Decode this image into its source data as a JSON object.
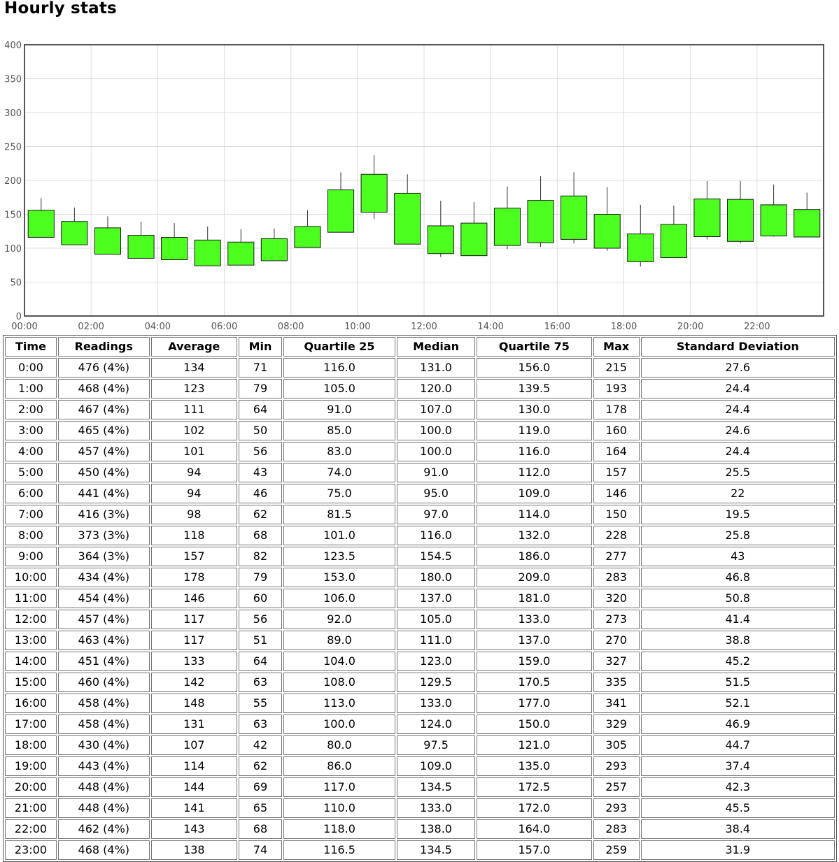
{
  "title": "Hourly stats",
  "chart_data": {
    "type": "candlestick",
    "ylim": [
      0,
      400
    ],
    "yticks": [
      "0",
      "50",
      "100",
      "150",
      "200",
      "250",
      "300",
      "350",
      "400"
    ],
    "xticks": [
      "00:00",
      "02:00",
      "04:00",
      "06:00",
      "08:00",
      "10:00",
      "12:00",
      "14:00",
      "16:00",
      "18:00",
      "20:00",
      "22:00"
    ],
    "box_color": "#4cff1f",
    "whisker_top": [
      174,
      160,
      147,
      139,
      137,
      132,
      128,
      129,
      156,
      212,
      237,
      209,
      170,
      168,
      191,
      206,
      212,
      190,
      164,
      163,
      199,
      199,
      194,
      182
    ],
    "whisker_bottom": [
      116,
      105,
      91,
      85,
      83,
      74,
      75,
      81.5,
      101,
      123.5,
      143,
      106,
      87,
      89,
      99,
      102,
      107,
      96,
      73,
      86,
      113,
      107,
      117,
      116.5
    ],
    "rows": [
      {
        "hour": 0,
        "q1": 116.0,
        "q3": 156.0
      },
      {
        "hour": 1,
        "q1": 105.0,
        "q3": 139.5
      },
      {
        "hour": 2,
        "q1": 91.0,
        "q3": 130.0
      },
      {
        "hour": 3,
        "q1": 85.0,
        "q3": 119.0
      },
      {
        "hour": 4,
        "q1": 83.0,
        "q3": 116.0
      },
      {
        "hour": 5,
        "q1": 74.0,
        "q3": 112.0
      },
      {
        "hour": 6,
        "q1": 75.0,
        "q3": 109.0
      },
      {
        "hour": 7,
        "q1": 81.5,
        "q3": 114.0
      },
      {
        "hour": 8,
        "q1": 101.0,
        "q3": 132.0
      },
      {
        "hour": 9,
        "q1": 123.5,
        "q3": 186.0
      },
      {
        "hour": 10,
        "q1": 153.0,
        "q3": 209.0
      },
      {
        "hour": 11,
        "q1": 106.0,
        "q3": 181.0
      },
      {
        "hour": 12,
        "q1": 92.0,
        "q3": 133.0
      },
      {
        "hour": 13,
        "q1": 89.0,
        "q3": 137.0
      },
      {
        "hour": 14,
        "q1": 104.0,
        "q3": 159.0
      },
      {
        "hour": 15,
        "q1": 108.0,
        "q3": 170.5
      },
      {
        "hour": 16,
        "q1": 113.0,
        "q3": 177.0
      },
      {
        "hour": 17,
        "q1": 100.0,
        "q3": 150.0
      },
      {
        "hour": 18,
        "q1": 80.0,
        "q3": 121.0
      },
      {
        "hour": 19,
        "q1": 86.0,
        "q3": 135.0
      },
      {
        "hour": 20,
        "q1": 117.0,
        "q3": 172.5
      },
      {
        "hour": 21,
        "q1": 110.0,
        "q3": 172.0
      },
      {
        "hour": 22,
        "q1": 118.0,
        "q3": 164.0
      },
      {
        "hour": 23,
        "q1": 116.5,
        "q3": 157.0
      }
    ]
  },
  "table": {
    "headers": [
      "Time",
      "Readings",
      "Average",
      "Min",
      "Quartile 25",
      "Median",
      "Quartile 75",
      "Max",
      "Standard Deviation"
    ],
    "rows": [
      [
        "0:00",
        "476 (4%)",
        "134",
        "71",
        "116.0",
        "131.0",
        "156.0",
        "215",
        "27.6"
      ],
      [
        "1:00",
        "468 (4%)",
        "123",
        "79",
        "105.0",
        "120.0",
        "139.5",
        "193",
        "24.4"
      ],
      [
        "2:00",
        "467 (4%)",
        "111",
        "64",
        "91.0",
        "107.0",
        "130.0",
        "178",
        "24.4"
      ],
      [
        "3:00",
        "465 (4%)",
        "102",
        "50",
        "85.0",
        "100.0",
        "119.0",
        "160",
        "24.6"
      ],
      [
        "4:00",
        "457 (4%)",
        "101",
        "56",
        "83.0",
        "100.0",
        "116.0",
        "164",
        "24.4"
      ],
      [
        "5:00",
        "450 (4%)",
        "94",
        "43",
        "74.0",
        "91.0",
        "112.0",
        "157",
        "25.5"
      ],
      [
        "6:00",
        "441 (4%)",
        "94",
        "46",
        "75.0",
        "95.0",
        "109.0",
        "146",
        "22"
      ],
      [
        "7:00",
        "416 (3%)",
        "98",
        "62",
        "81.5",
        "97.0",
        "114.0",
        "150",
        "19.5"
      ],
      [
        "8:00",
        "373 (3%)",
        "118",
        "68",
        "101.0",
        "116.0",
        "132.0",
        "228",
        "25.8"
      ],
      [
        "9:00",
        "364 (3%)",
        "157",
        "82",
        "123.5",
        "154.5",
        "186.0",
        "277",
        "43"
      ],
      [
        "10:00",
        "434 (4%)",
        "178",
        "79",
        "153.0",
        "180.0",
        "209.0",
        "283",
        "46.8"
      ],
      [
        "11:00",
        "454 (4%)",
        "146",
        "60",
        "106.0",
        "137.0",
        "181.0",
        "320",
        "50.8"
      ],
      [
        "12:00",
        "457 (4%)",
        "117",
        "56",
        "92.0",
        "105.0",
        "133.0",
        "273",
        "41.4"
      ],
      [
        "13:00",
        "463 (4%)",
        "117",
        "51",
        "89.0",
        "111.0",
        "137.0",
        "270",
        "38.8"
      ],
      [
        "14:00",
        "451 (4%)",
        "133",
        "64",
        "104.0",
        "123.0",
        "159.0",
        "327",
        "45.2"
      ],
      [
        "15:00",
        "460 (4%)",
        "142",
        "63",
        "108.0",
        "129.5",
        "170.5",
        "335",
        "51.5"
      ],
      [
        "16:00",
        "458 (4%)",
        "148",
        "55",
        "113.0",
        "133.0",
        "177.0",
        "341",
        "52.1"
      ],
      [
        "17:00",
        "458 (4%)",
        "131",
        "63",
        "100.0",
        "124.0",
        "150.0",
        "329",
        "46.9"
      ],
      [
        "18:00",
        "430 (4%)",
        "107",
        "42",
        "80.0",
        "97.5",
        "121.0",
        "305",
        "44.7"
      ],
      [
        "19:00",
        "443 (4%)",
        "114",
        "62",
        "86.0",
        "109.0",
        "135.0",
        "293",
        "37.4"
      ],
      [
        "20:00",
        "448 (4%)",
        "144",
        "69",
        "117.0",
        "134.5",
        "172.5",
        "257",
        "42.3"
      ],
      [
        "21:00",
        "448 (4%)",
        "141",
        "65",
        "110.0",
        "133.0",
        "172.0",
        "293",
        "45.5"
      ],
      [
        "22:00",
        "462 (4%)",
        "143",
        "68",
        "118.0",
        "138.0",
        "164.0",
        "283",
        "38.4"
      ],
      [
        "23:00",
        "468 (4%)",
        "138",
        "74",
        "116.5",
        "134.5",
        "157.0",
        "259",
        "31.9"
      ]
    ]
  }
}
